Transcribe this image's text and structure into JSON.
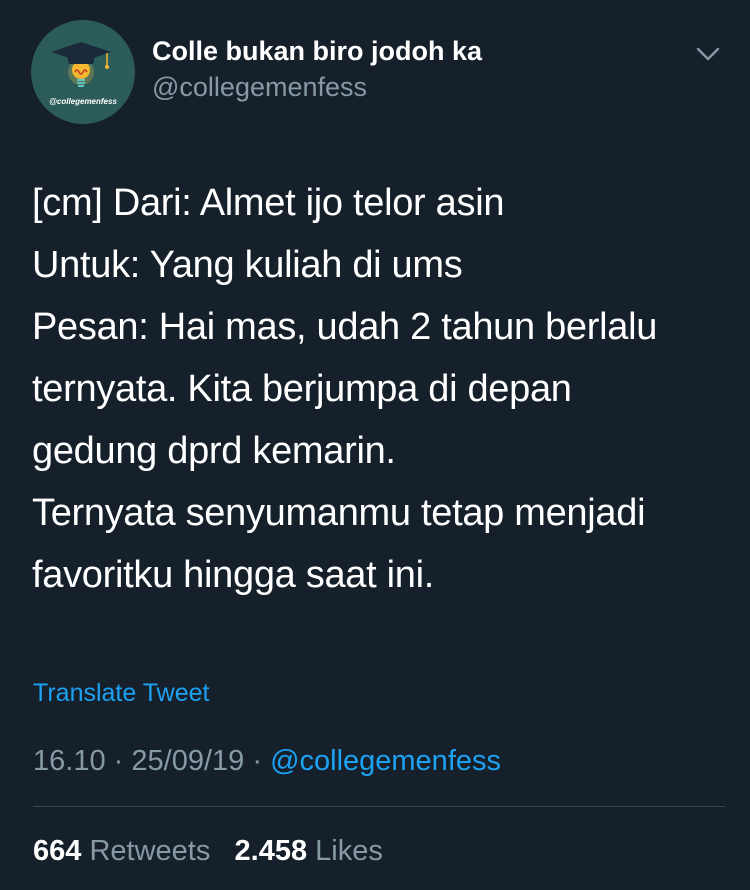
{
  "account": {
    "avatar_handle_text": "@collegemenfess",
    "display_name": "Colle bukan biro jodoh ka",
    "handle": "@collegemenfess"
  },
  "tweet": {
    "lines": [
      "[cm] Dari: Almet ijo telor asin",
      "Untuk: Yang kuliah di ums",
      "Pesan: Hai mas, udah 2 tahun berlalu",
      "ternyata. Kita berjumpa di depan",
      "gedung dprd kemarin.",
      "Ternyata senyumanmu tetap menjadi",
      "favoritku hingga saat ini."
    ],
    "translate_label": "Translate Tweet",
    "time": "16.10",
    "separator": "·",
    "date": "25/09/19",
    "via": "@collegemenfess"
  },
  "stats": {
    "retweets_count": "664",
    "retweets_label": "Retweets",
    "likes_count": "2.458",
    "likes_label": "Likes"
  },
  "icons": {
    "avatar": "graduation-cap-lightbulb-icon",
    "menu": "chevron-down-icon"
  },
  "colors": {
    "background": "#15202b",
    "text_primary": "#ffffff",
    "text_secondary": "#8899a6",
    "accent": "#1da1f2",
    "divider": "#38444d",
    "avatar_bg": "#2b5c5a"
  }
}
